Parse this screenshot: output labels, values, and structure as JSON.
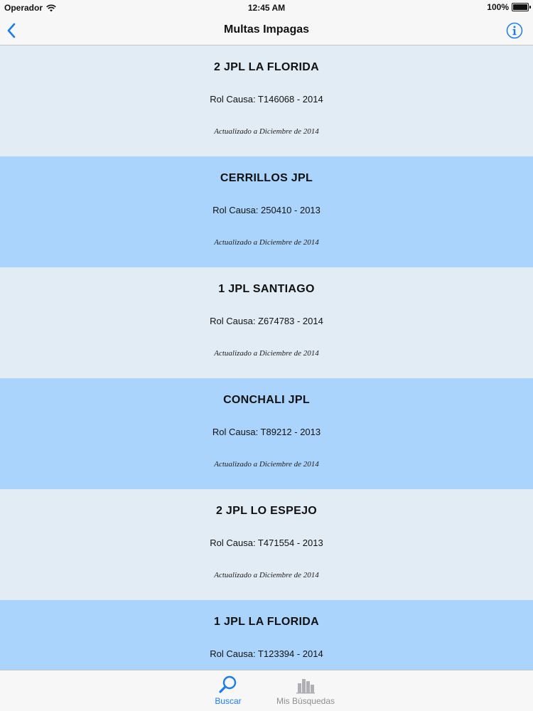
{
  "status": {
    "carrier": "Operador",
    "time": "12:45 AM",
    "battery": "100%"
  },
  "nav": {
    "title": "Multas Impagas"
  },
  "rows": [
    {
      "name": "2 JPL LA FLORIDA",
      "rol": "Rol Causa: T146068 - 2014",
      "updated": "Actualizado a Diciembre de 2014"
    },
    {
      "name": "CERRILLOS JPL",
      "rol": "Rol Causa: 250410 - 2013",
      "updated": "Actualizado a Diciembre de 2014"
    },
    {
      "name": "1 JPL SANTIAGO",
      "rol": "Rol Causa: Z674783 - 2014",
      "updated": "Actualizado a Diciembre de 2014"
    },
    {
      "name": "CONCHALI JPL",
      "rol": "Rol Causa: T89212 - 2013",
      "updated": "Actualizado a Diciembre de 2014"
    },
    {
      "name": "2 JPL LO ESPEJO",
      "rol": "Rol Causa: T471554 - 2013",
      "updated": "Actualizado a Diciembre de 2014"
    },
    {
      "name": "1 JPL LA FLORIDA",
      "rol": "Rol Causa: T123394 - 2014",
      "updated": ""
    }
  ],
  "tabs": {
    "buscar": "Buscar",
    "mis_busquedas": "Mis Búsquedas"
  },
  "colors": {
    "accent": "#1a7cf0",
    "row_light": "#e2ecf4",
    "row_blue": "#aad4fb"
  }
}
